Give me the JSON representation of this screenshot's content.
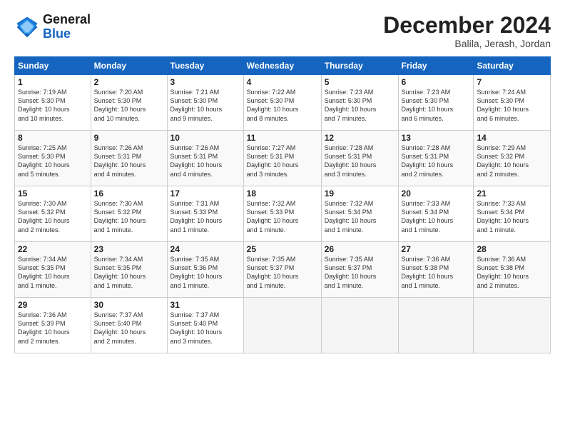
{
  "header": {
    "logo_line1": "General",
    "logo_line2": "Blue",
    "month_title": "December 2024",
    "location": "Balila, Jerash, Jordan"
  },
  "weekdays": [
    "Sunday",
    "Monday",
    "Tuesday",
    "Wednesday",
    "Thursday",
    "Friday",
    "Saturday"
  ],
  "weeks": [
    [
      {
        "day": "1",
        "info": "Sunrise: 7:19 AM\nSunset: 5:30 PM\nDaylight: 10 hours\nand 10 minutes."
      },
      {
        "day": "2",
        "info": "Sunrise: 7:20 AM\nSunset: 5:30 PM\nDaylight: 10 hours\nand 10 minutes."
      },
      {
        "day": "3",
        "info": "Sunrise: 7:21 AM\nSunset: 5:30 PM\nDaylight: 10 hours\nand 9 minutes."
      },
      {
        "day": "4",
        "info": "Sunrise: 7:22 AM\nSunset: 5:30 PM\nDaylight: 10 hours\nand 8 minutes."
      },
      {
        "day": "5",
        "info": "Sunrise: 7:23 AM\nSunset: 5:30 PM\nDaylight: 10 hours\nand 7 minutes."
      },
      {
        "day": "6",
        "info": "Sunrise: 7:23 AM\nSunset: 5:30 PM\nDaylight: 10 hours\nand 6 minutes."
      },
      {
        "day": "7",
        "info": "Sunrise: 7:24 AM\nSunset: 5:30 PM\nDaylight: 10 hours\nand 6 minutes."
      }
    ],
    [
      {
        "day": "8",
        "info": "Sunrise: 7:25 AM\nSunset: 5:30 PM\nDaylight: 10 hours\nand 5 minutes."
      },
      {
        "day": "9",
        "info": "Sunrise: 7:26 AM\nSunset: 5:31 PM\nDaylight: 10 hours\nand 4 minutes."
      },
      {
        "day": "10",
        "info": "Sunrise: 7:26 AM\nSunset: 5:31 PM\nDaylight: 10 hours\nand 4 minutes."
      },
      {
        "day": "11",
        "info": "Sunrise: 7:27 AM\nSunset: 5:31 PM\nDaylight: 10 hours\nand 3 minutes."
      },
      {
        "day": "12",
        "info": "Sunrise: 7:28 AM\nSunset: 5:31 PM\nDaylight: 10 hours\nand 3 minutes."
      },
      {
        "day": "13",
        "info": "Sunrise: 7:28 AM\nSunset: 5:31 PM\nDaylight: 10 hours\nand 2 minutes."
      },
      {
        "day": "14",
        "info": "Sunrise: 7:29 AM\nSunset: 5:32 PM\nDaylight: 10 hours\nand 2 minutes."
      }
    ],
    [
      {
        "day": "15",
        "info": "Sunrise: 7:30 AM\nSunset: 5:32 PM\nDaylight: 10 hours\nand 2 minutes."
      },
      {
        "day": "16",
        "info": "Sunrise: 7:30 AM\nSunset: 5:32 PM\nDaylight: 10 hours\nand 1 minute."
      },
      {
        "day": "17",
        "info": "Sunrise: 7:31 AM\nSunset: 5:33 PM\nDaylight: 10 hours\nand 1 minute."
      },
      {
        "day": "18",
        "info": "Sunrise: 7:32 AM\nSunset: 5:33 PM\nDaylight: 10 hours\nand 1 minute."
      },
      {
        "day": "19",
        "info": "Sunrise: 7:32 AM\nSunset: 5:34 PM\nDaylight: 10 hours\nand 1 minute."
      },
      {
        "day": "20",
        "info": "Sunrise: 7:33 AM\nSunset: 5:34 PM\nDaylight: 10 hours\nand 1 minute."
      },
      {
        "day": "21",
        "info": "Sunrise: 7:33 AM\nSunset: 5:34 PM\nDaylight: 10 hours\nand 1 minute."
      }
    ],
    [
      {
        "day": "22",
        "info": "Sunrise: 7:34 AM\nSunset: 5:35 PM\nDaylight: 10 hours\nand 1 minute."
      },
      {
        "day": "23",
        "info": "Sunrise: 7:34 AM\nSunset: 5:35 PM\nDaylight: 10 hours\nand 1 minute."
      },
      {
        "day": "24",
        "info": "Sunrise: 7:35 AM\nSunset: 5:36 PM\nDaylight: 10 hours\nand 1 minute."
      },
      {
        "day": "25",
        "info": "Sunrise: 7:35 AM\nSunset: 5:37 PM\nDaylight: 10 hours\nand 1 minute."
      },
      {
        "day": "26",
        "info": "Sunrise: 7:35 AM\nSunset: 5:37 PM\nDaylight: 10 hours\nand 1 minute."
      },
      {
        "day": "27",
        "info": "Sunrise: 7:36 AM\nSunset: 5:38 PM\nDaylight: 10 hours\nand 1 minute."
      },
      {
        "day": "28",
        "info": "Sunrise: 7:36 AM\nSunset: 5:38 PM\nDaylight: 10 hours\nand 2 minutes."
      }
    ],
    [
      {
        "day": "29",
        "info": "Sunrise: 7:36 AM\nSunset: 5:39 PM\nDaylight: 10 hours\nand 2 minutes."
      },
      {
        "day": "30",
        "info": "Sunrise: 7:37 AM\nSunset: 5:40 PM\nDaylight: 10 hours\nand 2 minutes."
      },
      {
        "day": "31",
        "info": "Sunrise: 7:37 AM\nSunset: 5:40 PM\nDaylight: 10 hours\nand 3 minutes."
      },
      {
        "day": "",
        "info": ""
      },
      {
        "day": "",
        "info": ""
      },
      {
        "day": "",
        "info": ""
      },
      {
        "day": "",
        "info": ""
      }
    ]
  ]
}
